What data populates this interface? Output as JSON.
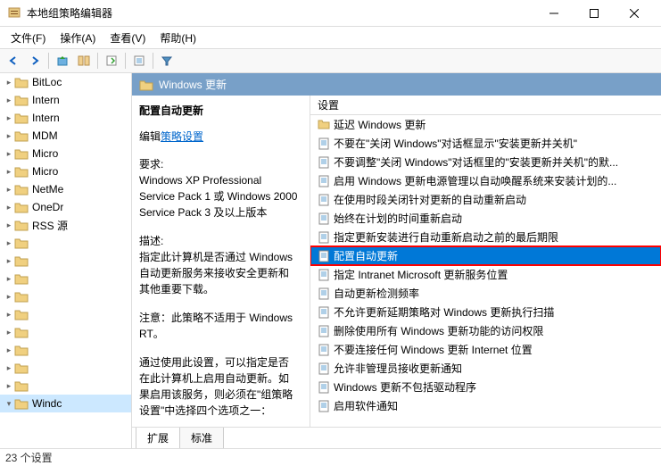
{
  "window": {
    "title": "本地组策略编辑器"
  },
  "menu": {
    "file": "文件(F)",
    "action": "操作(A)",
    "view": "查看(V)",
    "help": "帮助(H)"
  },
  "tree": {
    "items": [
      {
        "label": "BitLoc",
        "expanded": false
      },
      {
        "label": "Intern",
        "expanded": false
      },
      {
        "label": "Intern",
        "expanded": false
      },
      {
        "label": "MDM",
        "expanded": false
      },
      {
        "label": "Micro",
        "expanded": false
      },
      {
        "label": "Micro",
        "expanded": false
      },
      {
        "label": "NetMe",
        "expanded": false
      },
      {
        "label": "OneDr",
        "expanded": false
      },
      {
        "label": "RSS 源",
        "expanded": false
      },
      {
        "label": "",
        "expanded": false
      },
      {
        "label": "",
        "expanded": false
      },
      {
        "label": "",
        "expanded": false
      },
      {
        "label": "",
        "expanded": false
      },
      {
        "label": "",
        "expanded": false
      },
      {
        "label": "",
        "expanded": false
      },
      {
        "label": "",
        "expanded": false
      },
      {
        "label": "",
        "expanded": false
      },
      {
        "label": "",
        "expanded": false
      },
      {
        "label": "Windc",
        "expanded": true
      }
    ]
  },
  "content": {
    "header": "Windows 更新",
    "desc_title": "配置自动更新",
    "edit_prefix": "编辑",
    "edit_link": "策略设置",
    "req_label": "要求:",
    "req_text": "Windows XP Professional Service Pack 1 或 Windows 2000 Service Pack 3 及以上版本",
    "desc_label": "描述:",
    "desc_body1": "指定此计算机是否通过 Windows 自动更新服务来接收安全更新和其他重要下载。",
    "desc_body2": "注意：此策略不适用于 Windows RT。",
    "desc_body3": "通过使用此设置，可以指定是否在此计算机上启用自动更新。如果启用该服务，则必须在\"组策略设置\"中选择四个选项之一："
  },
  "list": {
    "header": "设置",
    "items": [
      {
        "type": "folder",
        "label": "延迟 Windows 更新"
      },
      {
        "type": "setting",
        "label": "不要在\"关闭 Windows\"对话框显示\"安装更新并关机\""
      },
      {
        "type": "setting",
        "label": "不要调整\"关闭 Windows\"对话框里的\"安装更新并关机\"的默..."
      },
      {
        "type": "setting",
        "label": "启用 Windows 更新电源管理以自动唤醒系统来安装计划的..."
      },
      {
        "type": "setting",
        "label": "在使用时段关闭针对更新的自动重新启动"
      },
      {
        "type": "setting",
        "label": "始终在计划的时间重新启动"
      },
      {
        "type": "setting",
        "label": "指定更新安装进行自动重新启动之前的最后期限"
      },
      {
        "type": "setting",
        "label": "配置自动更新",
        "selected": true
      },
      {
        "type": "setting",
        "label": "指定 Intranet Microsoft 更新服务位置"
      },
      {
        "type": "setting",
        "label": "自动更新检测频率"
      },
      {
        "type": "setting",
        "label": "不允许更新延期策略对 Windows 更新执行扫描"
      },
      {
        "type": "setting",
        "label": "删除使用所有 Windows 更新功能的访问权限"
      },
      {
        "type": "setting",
        "label": "不要连接任何 Windows 更新 Internet 位置"
      },
      {
        "type": "setting",
        "label": "允许非管理员接收更新通知"
      },
      {
        "type": "setting",
        "label": "Windows 更新不包括驱动程序"
      },
      {
        "type": "setting",
        "label": "启用软件通知"
      }
    ]
  },
  "tabs": {
    "extended": "扩展",
    "standard": "标准"
  },
  "status": {
    "text": "23 个设置"
  }
}
